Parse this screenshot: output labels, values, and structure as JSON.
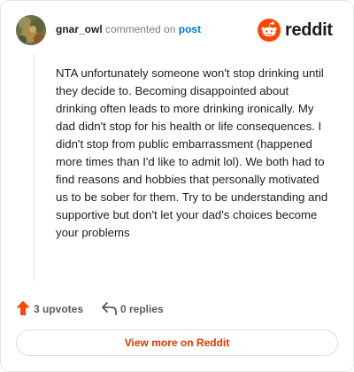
{
  "header": {
    "username": "gnar_owl",
    "action_text": "commented on",
    "post_link": "post",
    "brand_name": "reddit",
    "brand_color": "#ff4500"
  },
  "comment": {
    "text": "NTA unfortunately someone won't stop drinking until they decide to. Becoming disappointed about drinking often leads to more drinking ironically. My dad didn't stop for his health or life consequences. I didn't stop from public embarrassment (happened more times than I'd like to admit lol). We both had to find reasons and hobbies that personally motivated us to be sober for them. Try to be understanding and supportive but don't let your dad's choices become your problems"
  },
  "actions": {
    "upvotes_label": "3 upvotes",
    "replies_label": "0 replies",
    "upvote_icon": "upvote-arrow-icon",
    "reply_icon": "reply-arrow-icon",
    "upvote_color": "#ff4500"
  },
  "footer": {
    "view_more_label": "View more on Reddit",
    "view_more_color": "#d93a00"
  }
}
